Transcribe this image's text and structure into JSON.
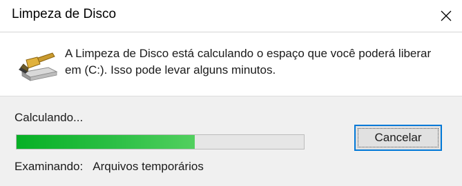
{
  "window": {
    "title": "Limpeza de Disco",
    "close_icon": "close-icon"
  },
  "info": {
    "icon": "disk-cleanup-icon",
    "message": "A Limpeza de Disco está calculando o espaço que você poderá liberar em  (C:). Isso pode levar alguns minutos."
  },
  "progress": {
    "status_label": "Calculando...",
    "fraction": 0.62,
    "color": "#06b025"
  },
  "actions": {
    "cancel_label": "Cancelar"
  },
  "scan": {
    "label": "Examinando:",
    "value": "Arquivos temporários"
  }
}
